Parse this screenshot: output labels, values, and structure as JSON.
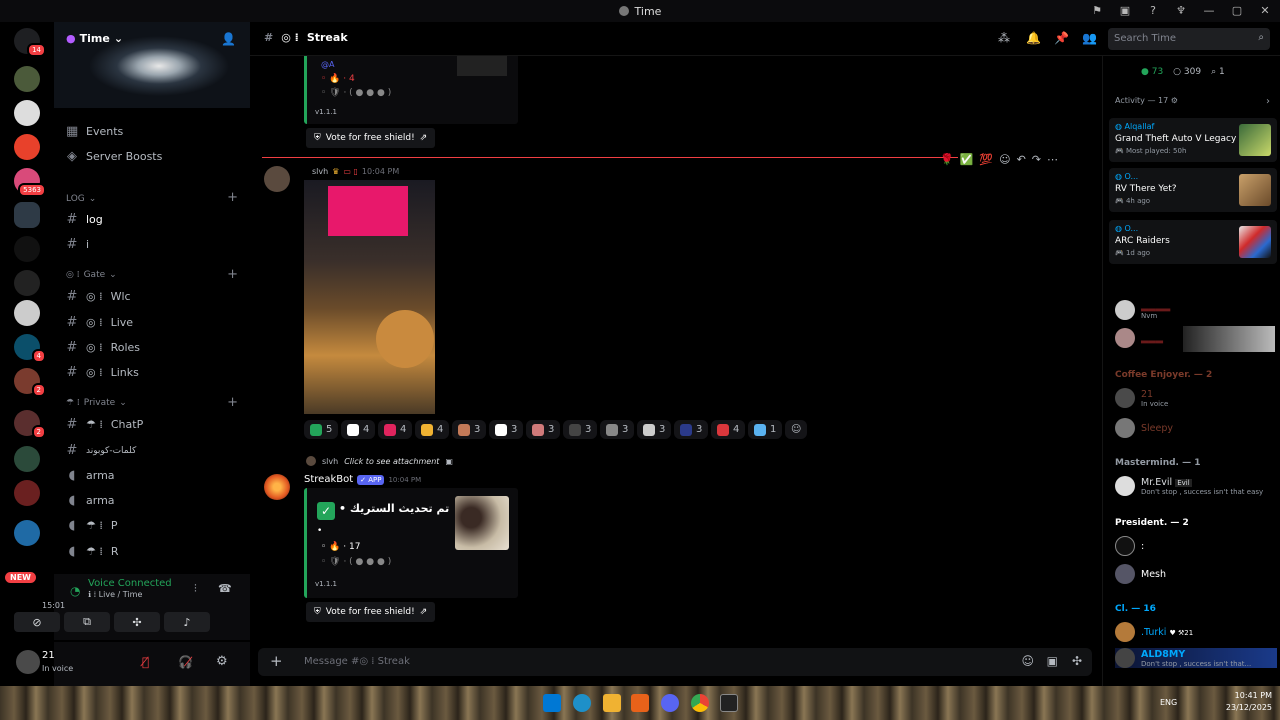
{
  "window": {
    "title": "Time"
  },
  "rail": {
    "badge_top": "14",
    "badge_a": "5363",
    "badge_b": "4",
    "badge_c": "2",
    "badge_d": "2",
    "new_label": "NEW"
  },
  "sidebar": {
    "server_name": "Time",
    "items": [
      "Events",
      "Server Boosts"
    ],
    "cat_log": "LOG",
    "channel_log": "log",
    "channel_i": "i",
    "cat_gate": "Gate",
    "gate_channels": [
      "Wlc",
      "Live",
      "Roles",
      "Links"
    ],
    "cat_private": "Private",
    "private_channels": [
      "ChatP",
      "كلمات-كوبوند",
      "arma",
      "arma",
      "P",
      "R"
    ]
  },
  "voice": {
    "status": "Voice Connected",
    "channel": "Live / Time",
    "timer": "15:01"
  },
  "user": {
    "name": "21",
    "status": "In voice"
  },
  "header": {
    "channel": "Streak",
    "search_placeholder": "Search Time"
  },
  "messages": {
    "top_embed": {
      "line1": "4",
      "version": "v1.1.1",
      "vote": "Vote for free shield!"
    },
    "photo_msg": {
      "author": "slvh",
      "time": "10:04 PM"
    },
    "reactions": [
      {
        "count": "5",
        "color": "#23a55a"
      },
      {
        "count": "4",
        "color": "#ffffff"
      },
      {
        "count": "4",
        "color": "#e0245e"
      },
      {
        "count": "4",
        "color": "#f0b232"
      },
      {
        "count": "3",
        "color": "#c47a58"
      },
      {
        "count": "3",
        "color": "#ffffff"
      },
      {
        "count": "3",
        "color": "#d07a7a"
      },
      {
        "count": "3",
        "color": "#444444"
      },
      {
        "count": "3",
        "color": "#888888"
      },
      {
        "count": "3",
        "color": "#cccccc"
      },
      {
        "count": "3",
        "color": "#2b3a8a"
      },
      {
        "count": "4",
        "color": "#da373c"
      },
      {
        "count": "1",
        "color": "#5ab2f0"
      }
    ],
    "reply": {
      "author": "slvh",
      "text": "Click to see attachment"
    },
    "bot": {
      "name": "StreakBot",
      "tag": "APP",
      "time": "10:04 PM",
      "title": "تم تحديث الستريك •",
      "bullet": "•",
      "streak": "17",
      "version": "v1.1.1",
      "vote": "Vote for free shield!"
    }
  },
  "composer": {
    "placeholder": "Message #◎ ⁞ Streak"
  },
  "members": {
    "stats": {
      "online": "73",
      "idle": "309",
      "voice": "1"
    },
    "activity_label": "Activity — 17",
    "activities": [
      {
        "user": "Alqallaf",
        "title": "Grand Theft Auto V Legacy",
        "meta": "Most played: 50h"
      },
      {
        "user": "O...",
        "title": "RV There Yet?",
        "meta": "4h ago"
      },
      {
        "user": "O...",
        "title": "ARC Raiders",
        "meta": "1d ago"
      }
    ],
    "red_member_status": "Nvm",
    "group_coffee": "Coffee Enjoyer. — 2",
    "coffee": [
      {
        "name": "21",
        "status": "In voice"
      },
      {
        "name": "Sleepy"
      }
    ],
    "group_master": "Mastermind. — 1",
    "master": {
      "name": "Mr.Evil",
      "tag": "Evil",
      "status": "Don't stop , success isn't that easy"
    },
    "group_president": "President. — 2",
    "president": [
      {
        "name": ":"
      },
      {
        "name": "Mesh"
      }
    ],
    "group_cl": "Cl. — 16",
    "cl": [
      {
        "name": ".Turki",
        "tag": "21"
      },
      {
        "name": "ALD8MY",
        "status": "Don't stop , success isn't that..."
      }
    ]
  },
  "taskbar": {
    "time": "10:41 PM",
    "date": "23/12/2025",
    "lang": "ENG"
  }
}
